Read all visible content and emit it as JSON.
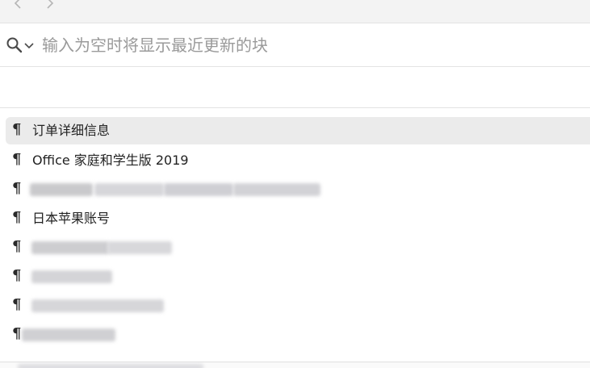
{
  "nav": {
    "back_icon": "chevron-left-icon",
    "forward_icon": "chevron-right-icon"
  },
  "search": {
    "icon": "search-icon",
    "dropdown_icon": "chevron-down-icon",
    "value": "",
    "placeholder": "输入为空时将显示最近更新的块"
  },
  "results": {
    "items": [
      {
        "icon": "paragraph-icon",
        "label": "订单详细信息",
        "selected": true,
        "redacted": false
      },
      {
        "icon": "paragraph-icon",
        "label": "Office 家庭和学生版 2019",
        "selected": false,
        "redacted": false
      },
      {
        "icon": "paragraph-icon",
        "label": "",
        "selected": false,
        "redacted": true
      },
      {
        "icon": "paragraph-icon",
        "label": "日本苹果账号",
        "selected": false,
        "redacted": false
      },
      {
        "icon": "paragraph-icon",
        "label": "",
        "selected": false,
        "redacted": true
      },
      {
        "icon": "paragraph-icon",
        "label": "",
        "selected": false,
        "redacted": true
      },
      {
        "icon": "paragraph-icon",
        "label": "",
        "selected": false,
        "redacted": true
      },
      {
        "icon": "paragraph-icon",
        "label": "",
        "selected": false,
        "redacted": true
      }
    ],
    "pilcrow_glyph": "¶"
  },
  "colors": {
    "topbar_bg": "#f3f3f3",
    "selected_row_bg": "#ebebeb",
    "placeholder": "#9a9a9a",
    "redaction": "#c8c8cc"
  }
}
